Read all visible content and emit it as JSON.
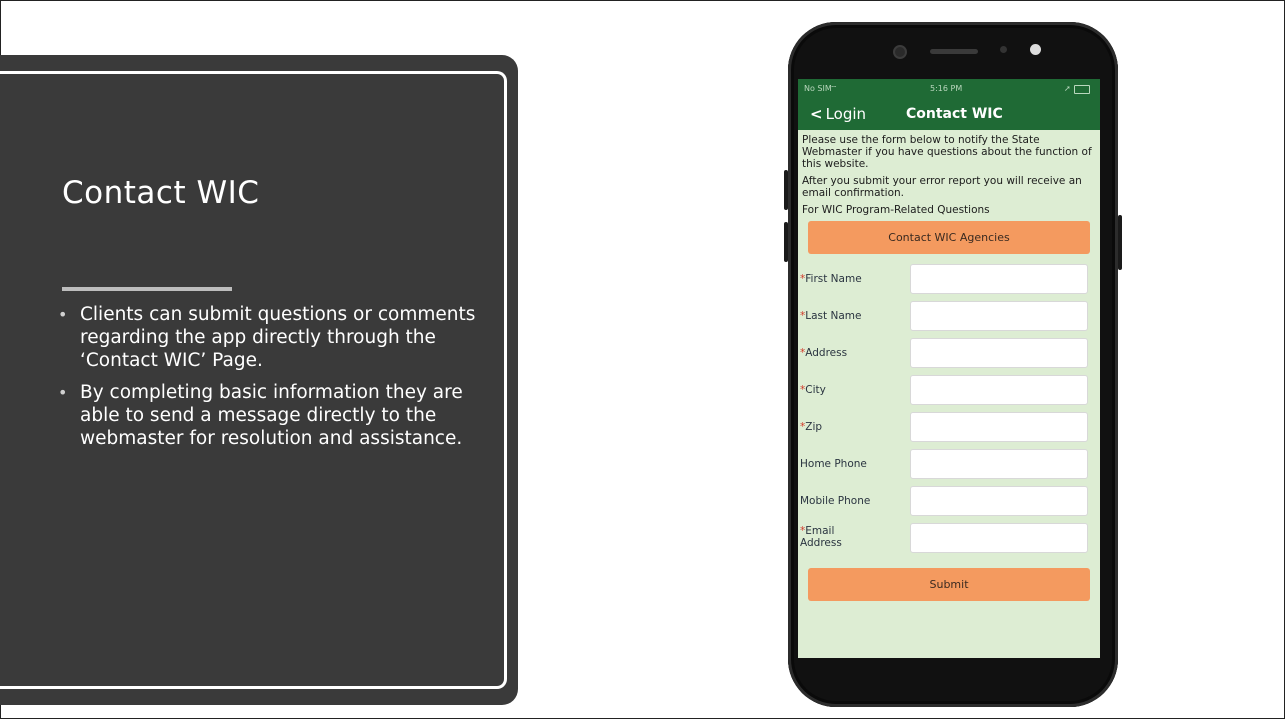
{
  "slide": {
    "title": "Contact WIC",
    "bullets": [
      "Clients can submit questions or comments regarding the app directly through the ‘Contact WIC’ Page.",
      "By completing basic information they are able to send a message directly to the webmaster for resolution and assistance."
    ]
  },
  "phone": {
    "status": {
      "carrier": "No SIM",
      "time": "5:16 PM"
    },
    "nav": {
      "back_label": "Login",
      "title": "Contact WIC"
    },
    "intro": [
      "Please use the form below to notify the State Webmaster if you have questions about the function of this website.",
      "After you submit your error report you will receive an email confirmation.",
      "For WIC Program-Related Questions"
    ],
    "agencies_button": "Contact WIC Agencies",
    "fields": [
      {
        "label": "First Name",
        "required": true,
        "value": ""
      },
      {
        "label": "Last Name",
        "required": true,
        "value": ""
      },
      {
        "label": "Address",
        "required": true,
        "value": ""
      },
      {
        "label": "City",
        "required": true,
        "value": ""
      },
      {
        "label": "Zip",
        "required": true,
        "value": ""
      },
      {
        "label": "Home Phone",
        "required": false,
        "value": ""
      },
      {
        "label": "Mobile Phone",
        "required": false,
        "value": ""
      },
      {
        "label": "Email Address",
        "required": true,
        "value": ""
      }
    ],
    "submit_label": "Submit"
  },
  "colors": {
    "panel": "#3a3a3a",
    "app_header": "#1f6a35",
    "app_background": "#ddedd3",
    "button": "#f49a5f",
    "required_marker": "#d23a2a"
  }
}
